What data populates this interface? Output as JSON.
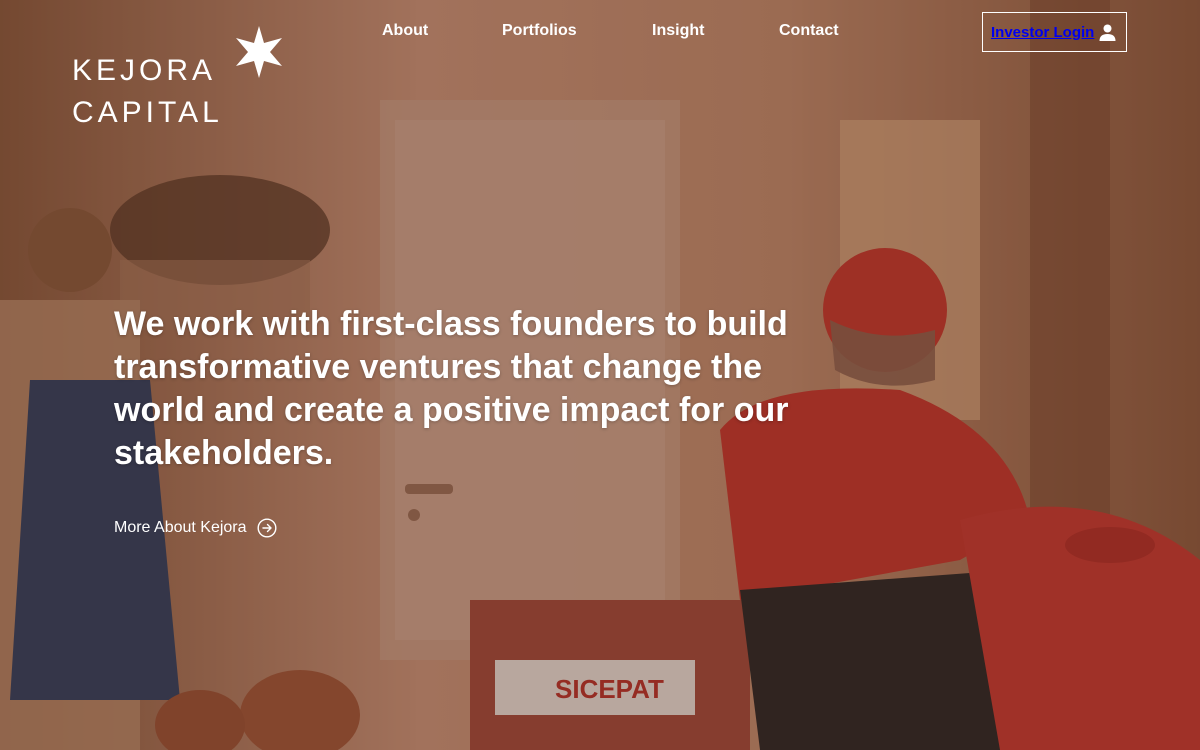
{
  "brand": {
    "line1": "KEJORA",
    "line2": "CAPITAL",
    "logo_icon": "star-icon"
  },
  "nav": {
    "items": [
      {
        "label": "About"
      },
      {
        "label": "Portfolios"
      },
      {
        "label": "Insight"
      },
      {
        "label": "Contact"
      }
    ]
  },
  "login": {
    "label": "Investor Login",
    "icon": "user-icon"
  },
  "hero": {
    "headline": "We work with first-class founders to build transformative ventures that change the world and create a positive impact for our stakeholders.",
    "cta_label": "More About Kejora",
    "cta_icon": "arrow-right-circle-icon",
    "background_text": "SICEPAT"
  },
  "colors": {
    "text": "#ffffff",
    "overlay": "#7a4a32",
    "accent_red": "#c93a33"
  }
}
